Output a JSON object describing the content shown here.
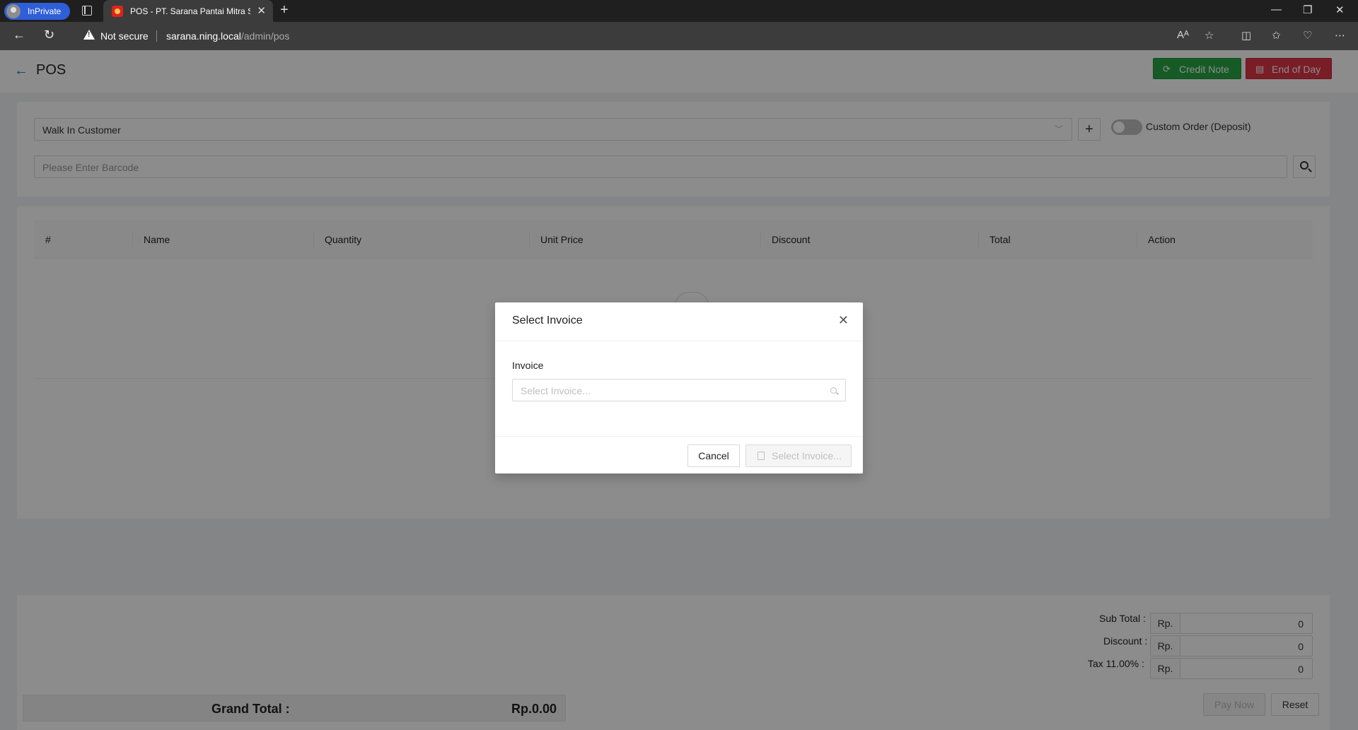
{
  "browser": {
    "inprivate_label": "InPrivate",
    "tab_title": "POS - PT. Sarana Pantai Mitra Se",
    "security_label": "Not secure",
    "url_host": "sarana.ning.local",
    "url_path": "/admin/pos"
  },
  "header": {
    "title": "POS",
    "credit_note_label": "Credit Note",
    "end_of_day_label": "End of Day"
  },
  "customer": {
    "selected": "Walk In Customer",
    "custom_order_label": "Custom Order (Deposit)",
    "custom_order_enabled": false
  },
  "barcode": {
    "placeholder": "Please Enter Barcode"
  },
  "table": {
    "columns": [
      "#",
      "Name",
      "Quantity",
      "Unit Price",
      "Discount",
      "Total",
      "Action"
    ]
  },
  "summary": {
    "sub_total_label": "Sub Total :",
    "discount_label": "Discount :",
    "tax_label": "Tax 11.00% :",
    "currency_prefix": "Rp.",
    "sub_total": "0",
    "discount": "0",
    "tax": "0",
    "grand_total_label": "Grand Total :",
    "grand_total": "Rp.0.00",
    "pay_now_label": "Pay Now",
    "reset_label": "Reset"
  },
  "modal": {
    "title": "Select Invoice",
    "field_label": "Invoice",
    "placeholder": "Select Invoice...",
    "cancel_label": "Cancel",
    "confirm_label": "Select Invoice..."
  },
  "colors": {
    "credit_note": "#28a745",
    "end_of_day": "#dc3545",
    "link": "#1e73be"
  }
}
